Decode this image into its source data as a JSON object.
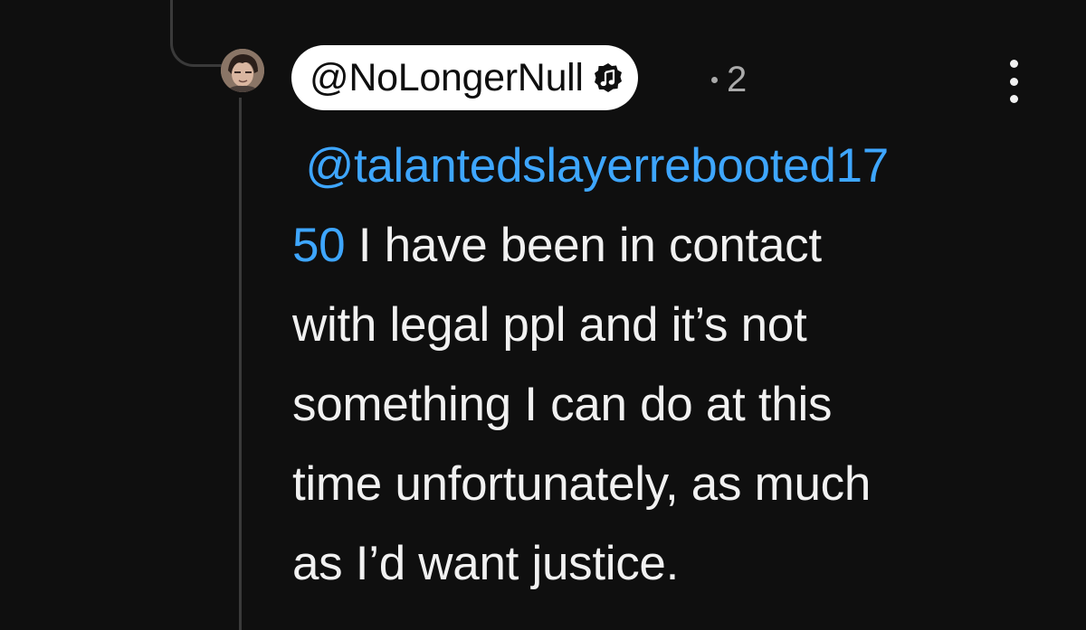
{
  "comment": {
    "author": "@NoLongerNull",
    "author_badge": "music-note-badge-icon",
    "meta_text": "2",
    "mention_part_1": "@talantedslayerrebooted17",
    "mention_part_2": "50",
    "body_lines": [
      "I have been in contact",
      "with legal ppl and it’s not",
      "something I can do at this",
      "time unfortunately, as much",
      "as I’d want justice."
    ]
  },
  "colors": {
    "background": "#0f0f0f",
    "text": "#f1f1f1",
    "mention": "#3ea6ff",
    "meta": "#aaaaaa",
    "author_chip": "#ffffff"
  }
}
